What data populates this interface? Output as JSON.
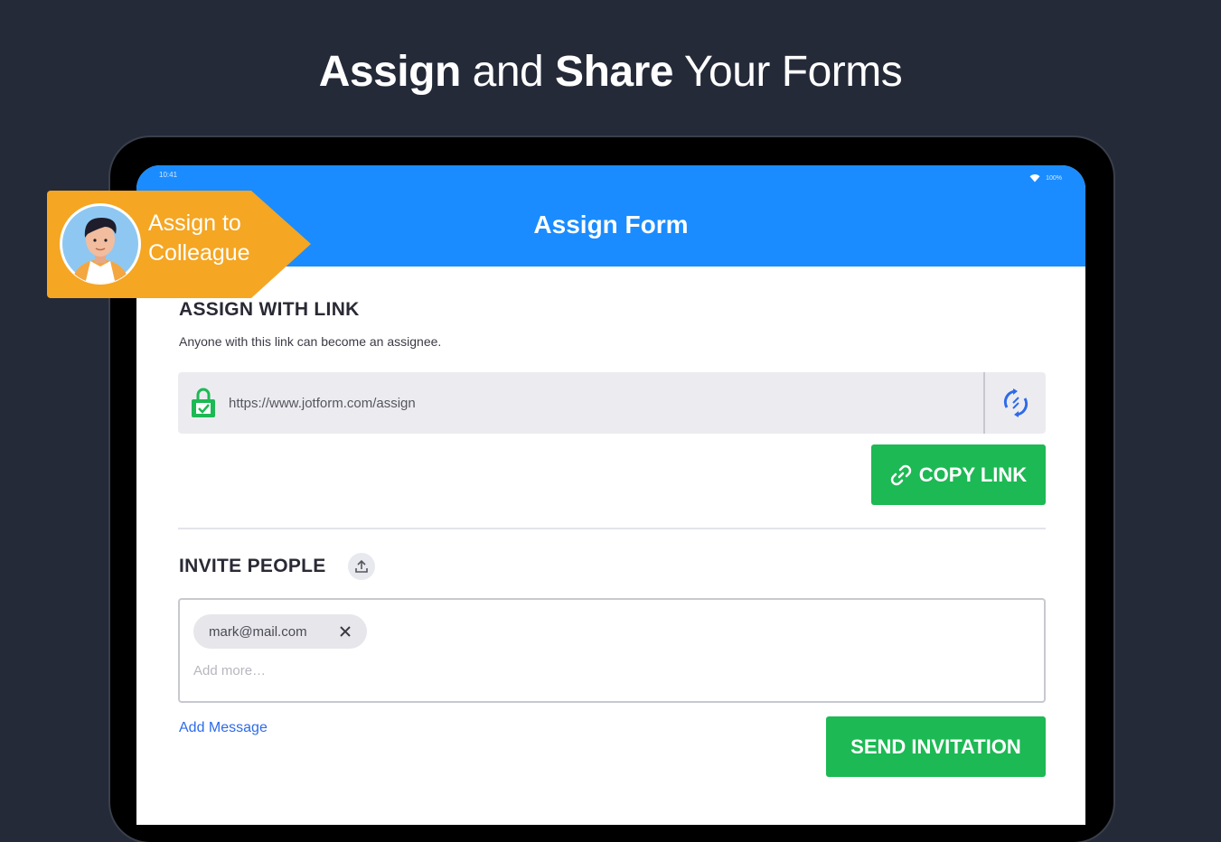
{
  "headline": {
    "part1": "Assign",
    "part2": " and ",
    "part3": "Share",
    "part4": " Your Forms"
  },
  "status_bar": {
    "time": "10:41",
    "battery": "100%"
  },
  "appbar": {
    "title": "Assign Form"
  },
  "badge": {
    "line1": "Assign to",
    "line2": "Colleague",
    "color": "#f5a623"
  },
  "assign_link": {
    "title": "ASSIGN WITH LINK",
    "subtitle": "Anyone with this link can become an assignee.",
    "url": "https://www.jotform.com/assign",
    "copy_label": "COPY LINK"
  },
  "invite": {
    "title": "INVITE PEOPLE",
    "chips": [
      "mark@mail.com"
    ],
    "placeholder": "Add more…",
    "add_message": "Add Message",
    "send_label": "SEND INVITATION"
  },
  "icons": [
    "lock-icon",
    "refresh-icon",
    "link-icon",
    "upload-icon",
    "close-icon",
    "wifi-icon"
  ],
  "colors": {
    "background": "#242a38",
    "appbar": "#1a8cff",
    "green": "#1db954",
    "badge": "#f5a623",
    "link": "#2d6bea"
  }
}
